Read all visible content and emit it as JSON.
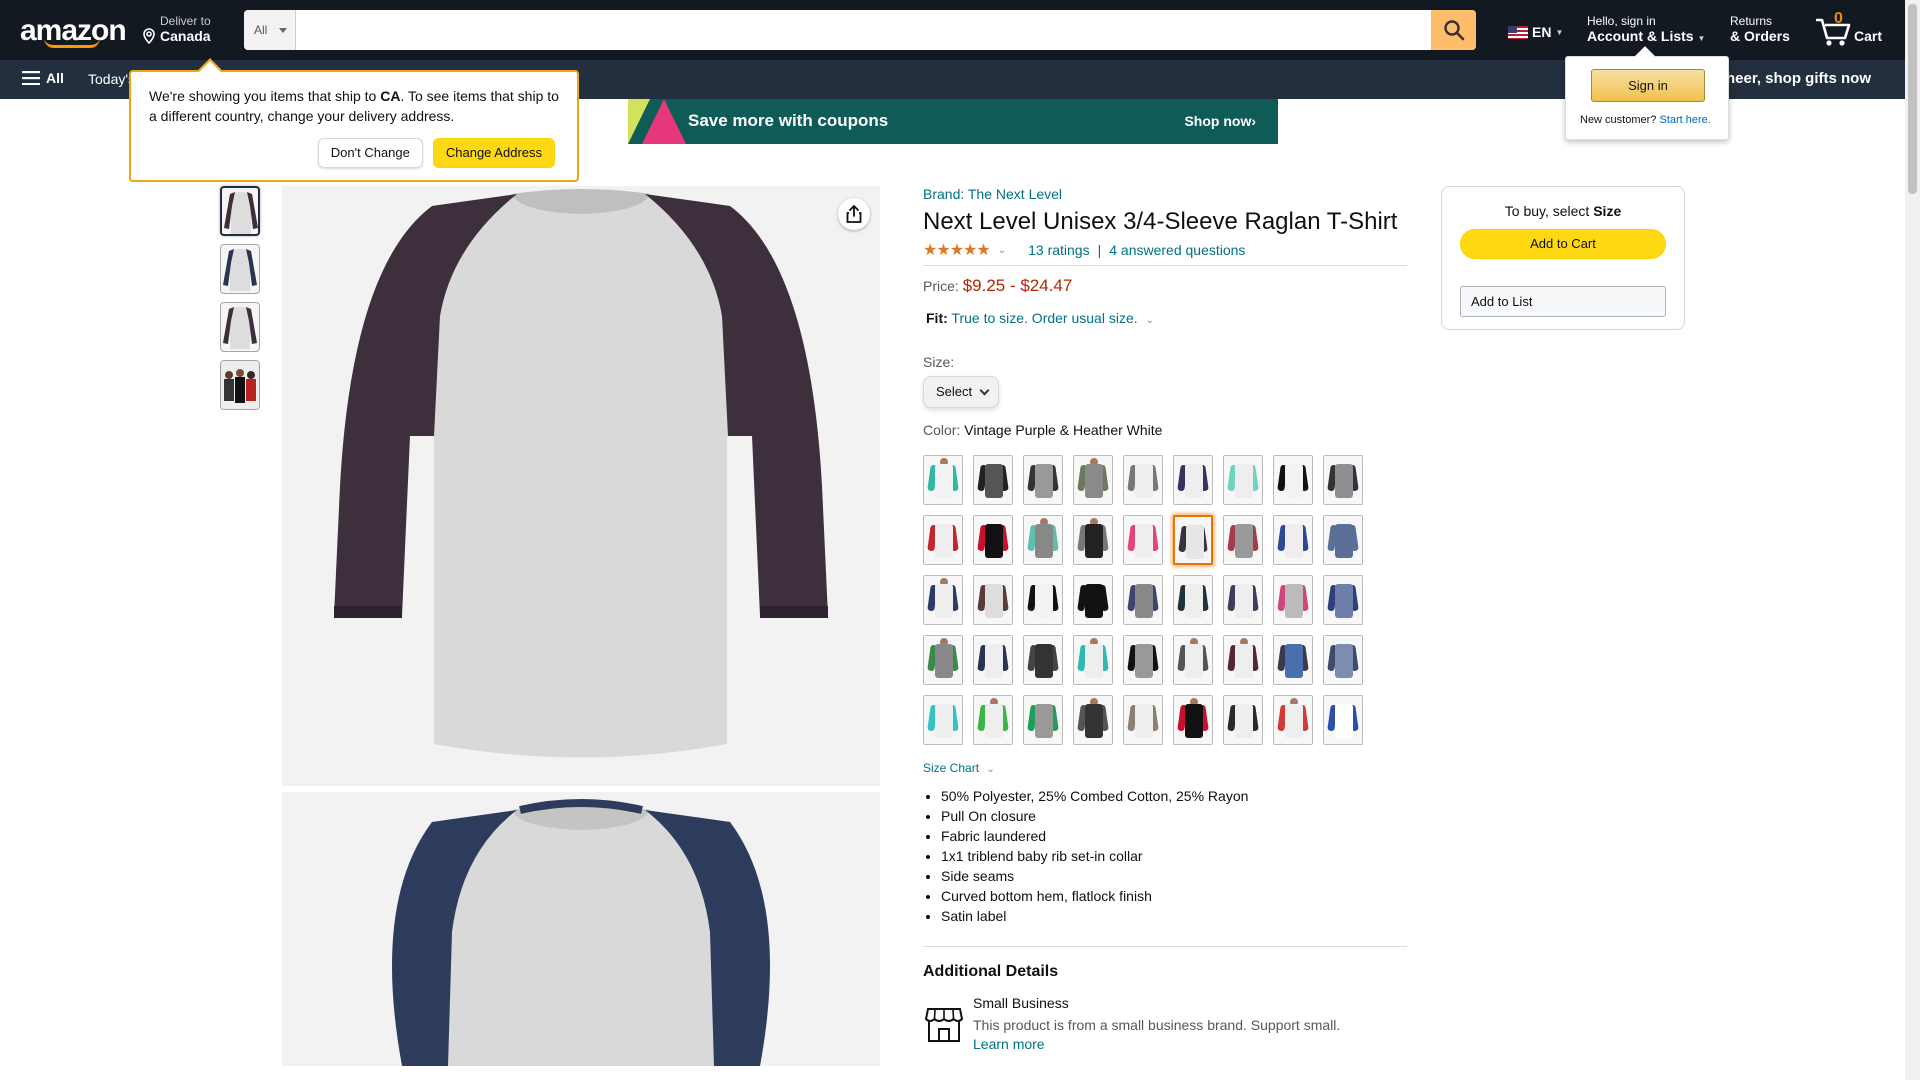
{
  "nav": {
    "logo": "amazon",
    "deliver_line1": "Deliver to",
    "deliver_line2": "Canada",
    "search_category": "All",
    "search_placeholder": "",
    "lang": "EN",
    "account_line1": "Hello, sign in",
    "account_line2": "Account & Lists",
    "returns_line1": "Returns",
    "returns_line2": "& Orders",
    "cart_count": "0",
    "cart_label": "Cart",
    "all_label": "All",
    "today_label": "Today's",
    "promo": "e cheer, shop gifts now"
  },
  "banner": {
    "text": "Save more with coupons",
    "cta": "Shop now›"
  },
  "popover": {
    "text_before": "We're showing you items that ship to ",
    "country": "CA",
    "text_after": ". To see items that ship to a different country, change your delivery address.",
    "dont_change": "Don't Change",
    "change_address": "Change Address"
  },
  "flyout": {
    "signin": "Sign in",
    "new_customer": "New customer?",
    "start_here": "Start here."
  },
  "product": {
    "brand": "Brand: The Next Level",
    "title": "Next Level Unisex 3/4-Sleeve Raglan T-Shirt",
    "stars": "★★★★★",
    "ratings": "13 ratings",
    "separator": "|",
    "questions": "4 answered questions",
    "price_label": "Price:",
    "price": "$9.25 - $24.47",
    "fit_label": "Fit:",
    "fit_value": "True to size. Order usual size.",
    "size_label": "Size:",
    "size_select": "Select",
    "color_label": "Color:",
    "color_value": "Vintage Purple & Heather White",
    "size_chart": "Size Chart",
    "bullets": [
      "50% Polyester, 25% Combed Cotton, 25% Rayon",
      "Pull On closure",
      "Fabric laundered",
      "1x1 triblend baby rib set-in collar",
      "Side seams",
      "Curved bottom hem, flatlock finish",
      "Satin label"
    ],
    "additional_details": "Additional Details",
    "small_business_title": "Small Business",
    "small_business_desc": "This product is from a small business brand. Support small.",
    "learn_more": "Learn more"
  },
  "buybox": {
    "note_prefix": "To buy, select ",
    "note_bold": "Size",
    "add_to_cart": "Add to Cart",
    "add_to_list": "Add to List"
  },
  "swatches": [
    {
      "body": "#f2f2f2",
      "sleeve": "#2fb9a3",
      "head": true
    },
    {
      "body": "#555",
      "sleeve": "#222",
      "head": false
    },
    {
      "body": "#999",
      "sleeve": "#333",
      "head": false
    },
    {
      "body": "#8a8a8a",
      "sleeve": "#6b7a5c",
      "head": true
    },
    {
      "body": "#eee",
      "sleeve": "#777",
      "head": false
    },
    {
      "body": "#eee",
      "sleeve": "#3a2f5e",
      "head": false
    },
    {
      "body": "#eee",
      "sleeve": "#6fd3c0",
      "head": false
    },
    {
      "body": "#f2f2f2",
      "sleeve": "#111",
      "head": false
    },
    {
      "body": "#8e8e93",
      "sleeve": "#333",
      "head": false
    },
    {
      "body": "#eee",
      "sleeve": "#c0282d",
      "head": false
    },
    {
      "body": "#111",
      "sleeve": "#c8102e",
      "head": false
    },
    {
      "body": "#888",
      "sleeve": "#5fbfae",
      "head": true
    },
    {
      "body": "#222",
      "sleeve": "#777",
      "head": true
    },
    {
      "body": "#eee",
      "sleeve": "#e0457b",
      "head": false
    },
    {
      "body": "#e6e6e6",
      "sleeve": "#3b3240",
      "head": false
    },
    {
      "body": "#9a9a9a",
      "sleeve": "#a33b4a",
      "head": false
    },
    {
      "body": "#eee",
      "sleeve": "#2c4a8f",
      "head": false
    },
    {
      "body": "#5b6e98",
      "sleeve": "#5b6e98",
      "head": false
    },
    {
      "body": "#eee",
      "sleeve": "#2b3d66",
      "head": true
    },
    {
      "body": "#ddd",
      "sleeve": "#5a3b3b",
      "head": false
    },
    {
      "body": "#f2f2f2",
      "sleeve": "#111",
      "head": false
    },
    {
      "body": "#111",
      "sleeve": "#111",
      "head": false
    },
    {
      "body": "#888",
      "sleeve": "#3e4470",
      "head": false
    },
    {
      "body": "#eee",
      "sleeve": "#21323f",
      "head": false
    },
    {
      "body": "#eee",
      "sleeve": "#433a5e",
      "head": false
    },
    {
      "body": "#bbb",
      "sleeve": "#d0457a",
      "head": false
    },
    {
      "body": "#6d7fa8",
      "sleeve": "#2e3f7c",
      "head": false
    },
    {
      "body": "#888",
      "sleeve": "#3a8a4a",
      "head": true
    },
    {
      "body": "#eee",
      "sleeve": "#2a3355",
      "head": false
    },
    {
      "body": "#333",
      "sleeve": "#444",
      "head": false
    },
    {
      "body": "#eee",
      "sleeve": "#2fb9b0",
      "head": true
    },
    {
      "body": "#999",
      "sleeve": "#111",
      "head": false
    },
    {
      "body": "#eee",
      "sleeve": "#555",
      "head": true
    },
    {
      "body": "#eee",
      "sleeve": "#55282f",
      "head": true
    },
    {
      "body": "#4a6fae",
      "sleeve": "#3a3a4a",
      "head": false
    },
    {
      "body": "#7d8db0",
      "sleeve": "#3e4a6e",
      "head": false
    },
    {
      "body": "#eee",
      "sleeve": "#35c2c0",
      "head": false
    },
    {
      "body": "#eee",
      "sleeve": "#39b549",
      "head": true
    },
    {
      "body": "#999",
      "sleeve": "#1e9e5a",
      "head": false
    },
    {
      "body": "#333",
      "sleeve": "#555",
      "head": true
    },
    {
      "body": "#eee",
      "sleeve": "#8c8070",
      "head": false
    },
    {
      "body": "#111",
      "sleeve": "#c8102e",
      "head": true
    },
    {
      "body": "#eee",
      "sleeve": "#2a2a2a",
      "head": false
    },
    {
      "body": "#eee",
      "sleeve": "#d23a3a",
      "head": true
    },
    {
      "body": "#fff",
      "sleeve": "#2c4faa",
      "head": false
    }
  ]
}
